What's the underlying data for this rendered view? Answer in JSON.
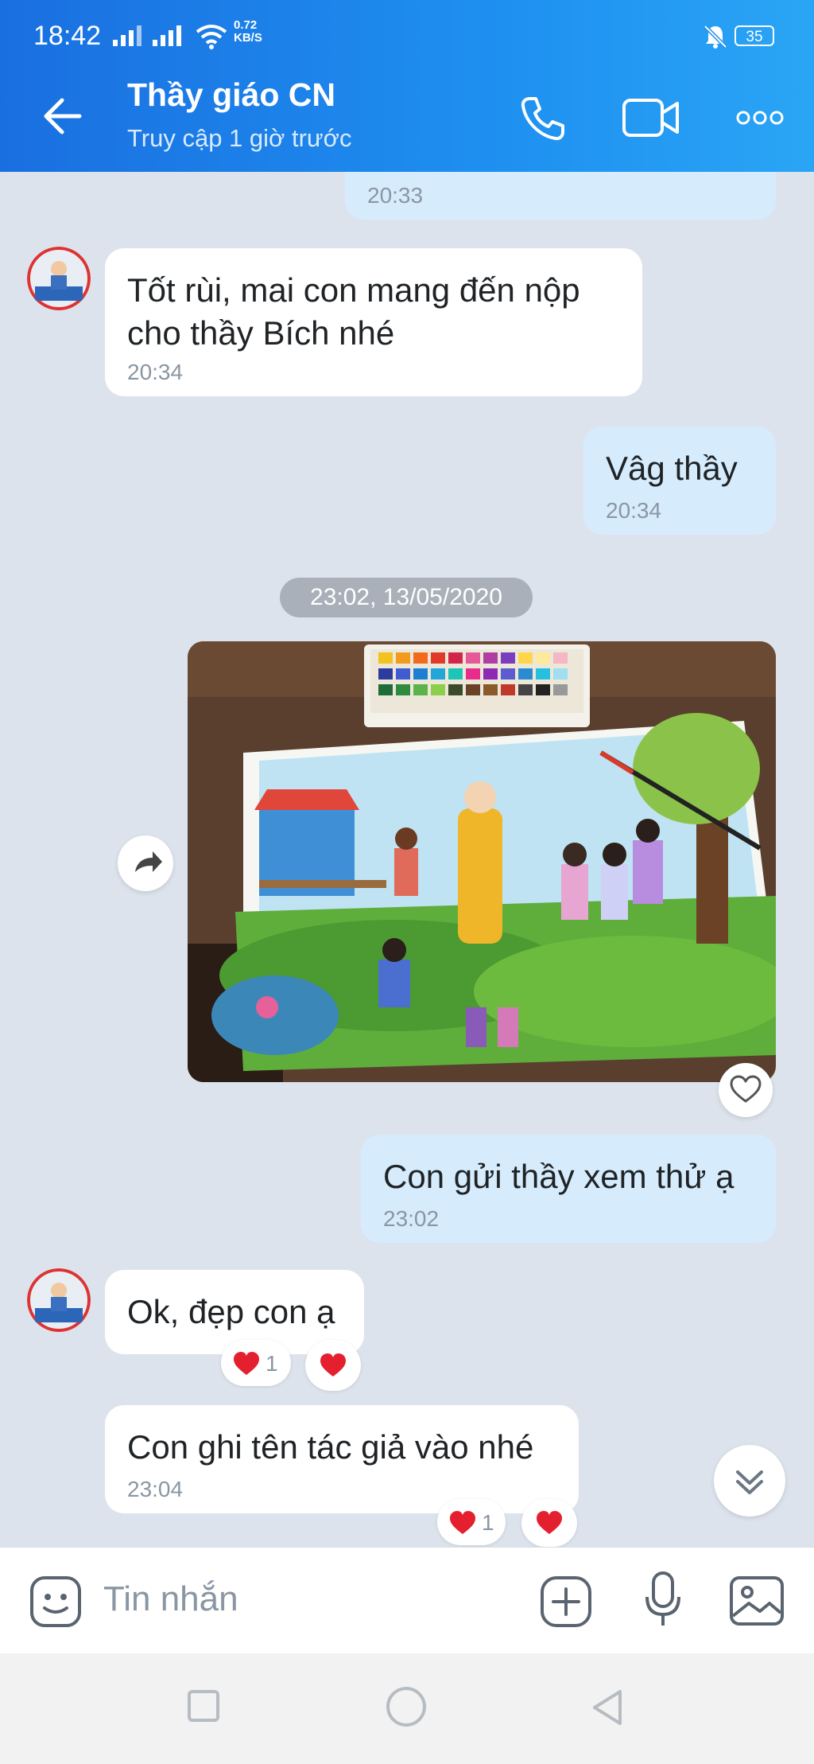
{
  "status_bar": {
    "time": "18:42",
    "net_speed_value": "0.72",
    "net_speed_unit": "KB/S",
    "battery": "35"
  },
  "header": {
    "title": "Thầy giáo CN",
    "subtitle": "Truy cập 1 giờ trước",
    "icons": [
      "back-arrow-icon",
      "phone-icon",
      "video-call-icon",
      "more-icon"
    ]
  },
  "messages": [
    {
      "side": "out",
      "text": "",
      "time": "20:33"
    },
    {
      "side": "in",
      "text_line1": "Tốt rùi, mai con mang đến nộp",
      "text_line2": "cho thầy Bích nhé",
      "time": "20:34"
    },
    {
      "side": "out",
      "text": "Vâg thầy",
      "time": "20:34"
    },
    {
      "side": "out",
      "text": "Con gửi thầy xem thử ạ",
      "time": "23:02"
    },
    {
      "side": "in",
      "text": "Ok, đẹp con ạ",
      "reaction_count": "1"
    },
    {
      "side": "in",
      "text": "Con ghi tên tác giả vào nhé",
      "time": "23:04",
      "reaction_count": "1"
    }
  ],
  "date_separator": "23:02, 13/05/2020",
  "input": {
    "placeholder": "Tin nhắn"
  },
  "colors": {
    "header_gradient_start": "#1a6fe0",
    "header_gradient_end": "#2aa5f5",
    "chat_background": "#dde3ec",
    "outgoing_bubble": "#d6ecfd",
    "incoming_bubble": "#ffffff",
    "heart": "#e5202e"
  }
}
